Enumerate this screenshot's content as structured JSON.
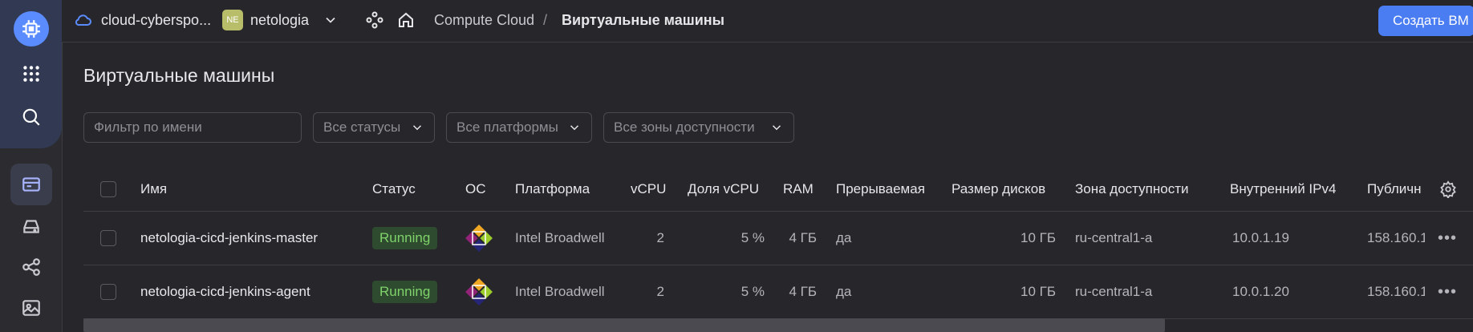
{
  "header": {
    "cloud_name": "cloud-cyberspo...",
    "folder_badge": "NE",
    "folder_name": "netologia",
    "breadcrumb_service": "Compute Cloud",
    "breadcrumb_separator": "/",
    "breadcrumb_current": "Виртуальные машины",
    "create_button": "Создать ВМ"
  },
  "page": {
    "title": "Виртуальные машины"
  },
  "filters": {
    "name_placeholder": "Фильтр по имени",
    "status": "Все статусы",
    "platform": "Все платформы",
    "zone": "Все зоны доступности"
  },
  "table": {
    "columns": {
      "name": "Имя",
      "status": "Статус",
      "os": "ОС",
      "platform": "Платформа",
      "vcpu": "vCPU",
      "vcpu_share": "Доля vCPU",
      "ram": "RAM",
      "preemptible": "Прерываемая",
      "disk": "Размер дисков",
      "zone": "Зона доступности",
      "ipv4": "Внутренний IPv4",
      "public": "Публичн"
    },
    "rows": [
      {
        "name": "netologia-cicd-jenkins-master",
        "status": "Running",
        "platform": "Intel Broadwell",
        "vcpu": "2",
        "vcpu_share": "5 %",
        "ram": "4 ГБ",
        "preemptible": "да",
        "disk": "10 ГБ",
        "zone": "ru-central1-a",
        "ipv4": "10.0.1.19",
        "public": "158.160.1"
      },
      {
        "name": "netologia-cicd-jenkins-agent",
        "status": "Running",
        "platform": "Intel Broadwell",
        "vcpu": "2",
        "vcpu_share": "5 %",
        "ram": "4 ГБ",
        "preemptible": "да",
        "disk": "10 ГБ",
        "zone": "ru-central1-a",
        "ipv4": "10.0.1.20",
        "public": "158.160.1"
      }
    ]
  },
  "icons": {
    "logo": "chip-icon",
    "services": "grid-icon",
    "search": "search-icon",
    "compute": "card-icon",
    "storage": "drive-icon",
    "network": "share-icon",
    "images": "image-icon",
    "cloud": "cloud-icon",
    "resources": "nodes-icon",
    "home": "home-icon",
    "os": "centos-icon",
    "settings": "gear-icon",
    "more": "more-icon"
  },
  "colors": {
    "accent": "#4a7cf2",
    "status_running_bg": "#2e4a2f",
    "status_running_text": "#7fd36a"
  }
}
